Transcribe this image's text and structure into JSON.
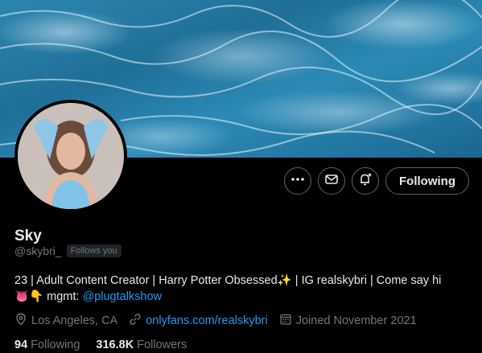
{
  "profile": {
    "name": "Sky",
    "handle": "@skybri_",
    "follows_you": "Follows you",
    "bio_line1": "23 | Adult Content Creator | Harry Potter Obsessed",
    "bio_line1_rest": " | IG realskybri | Come say hi",
    "bio_line2_prefix": " mgmt: ",
    "bio_mention": "@plugtalkshow",
    "location": "Los Angeles, CA",
    "website": "onlyfans.com/realskybri",
    "joined": "Joined November 2021",
    "following_count": "94",
    "following_label": "Following",
    "followers_count": "316.8K",
    "followers_label": "Followers"
  },
  "actions": {
    "following_button": "Following"
  },
  "icons": {
    "more": "more-icon",
    "message": "mail-icon",
    "notify": "bell-plus-icon",
    "location": "location-pin-icon",
    "link": "link-icon",
    "calendar": "calendar-icon"
  },
  "colors": {
    "background": "#000000",
    "accent": "#1d9bf0",
    "secondary_text": "#71767b"
  }
}
